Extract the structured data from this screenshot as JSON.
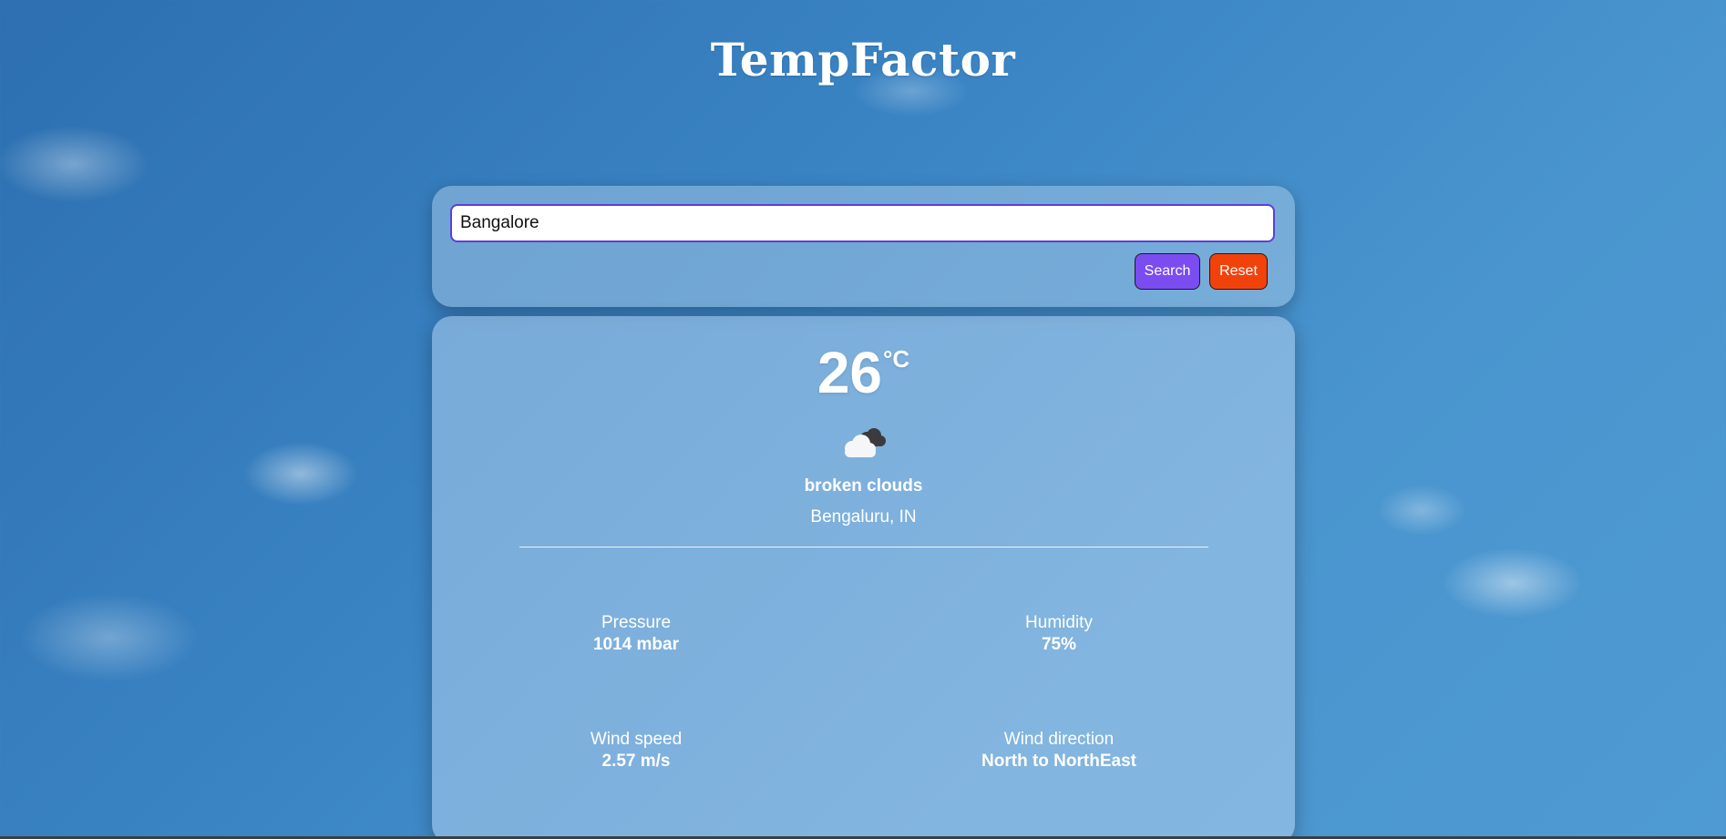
{
  "app": {
    "title": "TempFactor"
  },
  "search": {
    "value": "Bangalore",
    "search_label": "Search",
    "reset_label": "Reset"
  },
  "weather": {
    "temperature": "26",
    "unit": "°C",
    "icon": "broken-clouds-icon",
    "condition": "broken clouds",
    "location": "Bengaluru, IN",
    "stats": {
      "pressure": {
        "label": "Pressure",
        "value": "1014 mbar"
      },
      "humidity": {
        "label": "Humidity",
        "value": "75%"
      },
      "wind_speed": {
        "label": "Wind speed",
        "value": "2.57 m/s"
      },
      "wind_direction": {
        "label": "Wind direction",
        "value": "North to NorthEast"
      }
    }
  },
  "colors": {
    "search_button": "#7b4cf0",
    "reset_button": "#f2420c",
    "input_border": "#5b3fd6"
  }
}
